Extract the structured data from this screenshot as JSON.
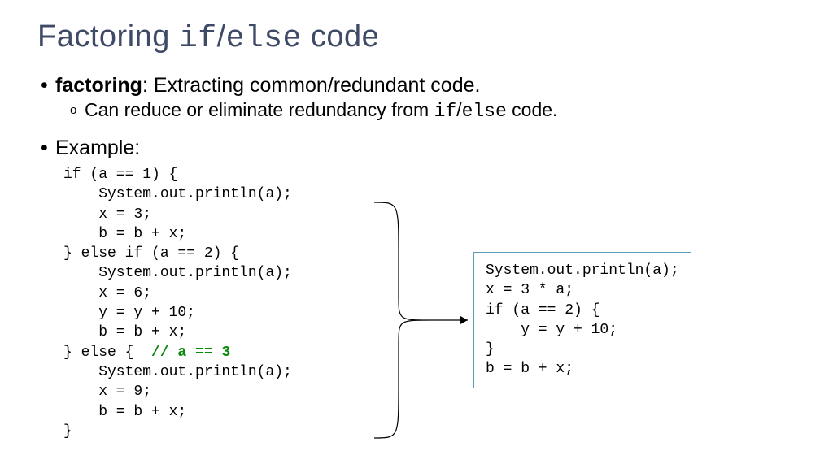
{
  "title": {
    "part1": "Factoring ",
    "mono1": "if",
    "slash": "/",
    "mono2": "else",
    "part2": " code"
  },
  "bullet1": {
    "term": "factoring",
    "rest": ": Extracting common/redundant code."
  },
  "sub1": {
    "part1": "Can reduce or eliminate redundancy from ",
    "mono1": "if",
    "slash": "/",
    "mono2": "else",
    "part2": " code."
  },
  "example_label": "Example:",
  "left_code": {
    "l1": "if (a == 1) {",
    "l2": "    System.out.println(a);",
    "l3": "    x = 3;",
    "l4": "    b = b + x;",
    "l5": "} else if (a == 2) {",
    "l6": "    System.out.println(a);",
    "l7": "    x = 6;",
    "l8": "    y = y + 10;",
    "l9": "    b = b + x;",
    "l10a": "} else {  ",
    "l10b": "// a == 3",
    "l11": "    System.out.println(a);",
    "l12": "    x = 9;",
    "l13": "    b = b + x;",
    "l14": "}"
  },
  "right_code": "System.out.println(a);\nx = 3 * a;\nif (a == 2) {\n    y = y + 10;\n}\nb = b + x;"
}
